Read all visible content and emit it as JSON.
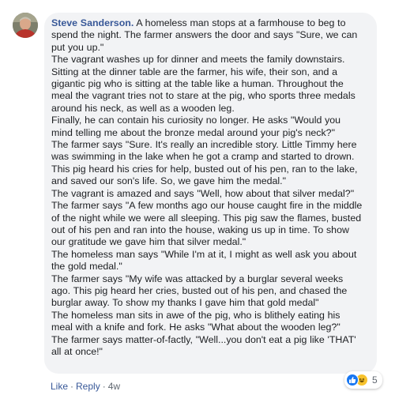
{
  "comment": {
    "author": "Steve Sanderson.",
    "lines": [
      " A homeless man stops at a farmhouse to beg to",
      "spend the night. The farmer answers the door and says \"Sure, we can",
      "put you up.\"",
      "The vagrant washes up for dinner and meets the family downstairs.",
      "Sitting at the dinner table are the farmer, his wife, their son, and a",
      "gigantic pig who is sitting at the table like a human. Throughout the",
      "meal the vagrant tries not to stare at the pig, who sports three medals",
      "around his neck, as well as a wooden leg.",
      "Finally, he can contain his curiosity no longer. He asks \"Would you",
      "mind telling me about the bronze medal around your pig's neck?\"",
      "The farmer says \"Sure. It's really an incredible story. Little Timmy here",
      "was swimming in the lake when he got a cramp and started to drown.",
      "This pig heard his cries for help, busted out of his pen, ran to the lake,",
      "and saved our son's life. So, we gave him the medal.\"",
      "The vagrant is amazed and says \"Well, how about that silver medal?\"",
      "The farmer says \"A few months ago our house caught fire in the middle",
      "of the night while we were all sleeping. This pig saw the flames, busted",
      "out of his pen and ran into the house, waking us up in time. To show",
      "our gratitude we gave him that silver medal.\"",
      "The homeless man says \"While I'm at it, I might as well ask you about",
      "the gold medal.\"",
      "The farmer says \"My wife was attacked by a burglar several weeks",
      "ago. This pig heard her cries, busted out of his pen, and chased the",
      "burglar away. To show my thanks I gave him that gold medal\"",
      "The homeless man sits in awe of the pig, who is blithely eating his",
      "meal with a knife and fork. He asks \"What about the wooden leg?\"",
      "The farmer says matter-of-factly, \"Well...you don't eat a pig like 'THAT'",
      "all at once!\""
    ]
  },
  "reactions": {
    "icons": [
      "like-icon",
      "haha-icon"
    ],
    "count": "5"
  },
  "actions": {
    "like": "Like",
    "separator": "·",
    "reply": "Reply",
    "time": "4w"
  },
  "colors": {
    "bubble": "#f2f3f5",
    "author": "#385898",
    "text": "#1c1e21",
    "meta": "#606770",
    "like": "#1877f2",
    "haha": "#f7c22d"
  }
}
